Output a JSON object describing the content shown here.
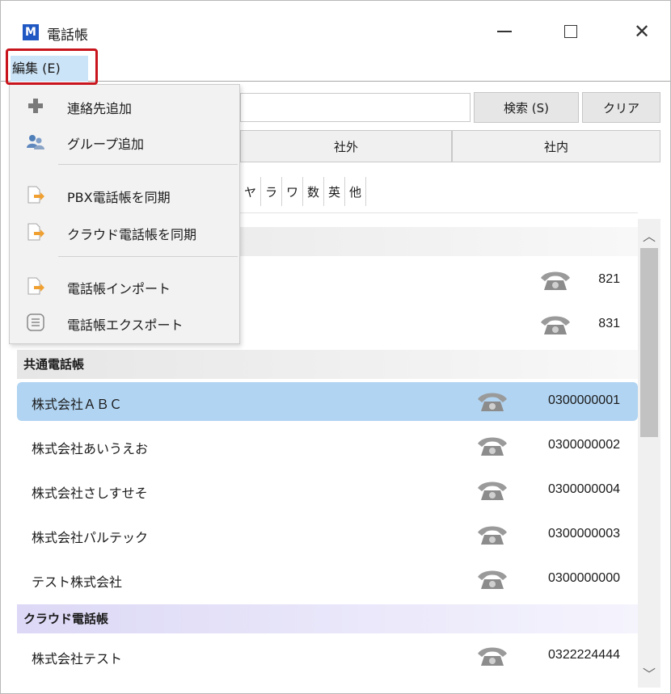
{
  "window": {
    "logo": "M",
    "title": "電話帳",
    "controls": [
      "minimize-icon",
      "maximize-icon",
      "close-icon"
    ]
  },
  "menubar": {
    "edit_label": "編集 (E)"
  },
  "edit_menu": {
    "items": [
      {
        "label": "連絡先追加",
        "icon": "plus-icon"
      },
      {
        "label": "グループ追加",
        "icon": "group-icon"
      },
      {
        "label": "PBX電話帳を同期",
        "icon": "sync-arrow-icon"
      },
      {
        "label": "クラウド電話帳を同期",
        "icon": "sync-arrow-icon"
      },
      {
        "label": "電話帳インポート",
        "icon": "import-arrow-icon"
      },
      {
        "label": "電話帳エクスポート",
        "icon": "export-list-icon"
      }
    ]
  },
  "search": {
    "placeholder": "",
    "search_button": "検索 (S)",
    "clear_button": "クリア"
  },
  "tabs": [
    {
      "label": "社外"
    },
    {
      "label": "社内"
    }
  ],
  "kana_filter": [
    "ヤ",
    "ラ",
    "ワ",
    "数",
    "英",
    "他"
  ],
  "list": {
    "partial_rows": [
      {
        "phone": "821"
      },
      {
        "phone": "831"
      }
    ],
    "groups": [
      {
        "name": "共通電話帳",
        "contacts": [
          {
            "name": "株式会社ＡＢＣ",
            "phone": "0300000001",
            "selected": true
          },
          {
            "name": "株式会社あいうえお",
            "phone": "0300000002"
          },
          {
            "name": "株式会社さしすせそ",
            "phone": "0300000004"
          },
          {
            "name": "株式会社パルテック",
            "phone": "0300000003"
          },
          {
            "name": "テスト株式会社",
            "phone": "0300000000"
          }
        ]
      },
      {
        "name": "クラウド電話帳",
        "contacts": [
          {
            "name": "株式会社テスト",
            "phone": "0322224444"
          }
        ]
      }
    ]
  },
  "colors": {
    "selected_row": "#b1d4f2",
    "menu_highlight": "#cce4f7",
    "callout_border": "#c8141c",
    "logo_blue": "#1f57c3"
  }
}
